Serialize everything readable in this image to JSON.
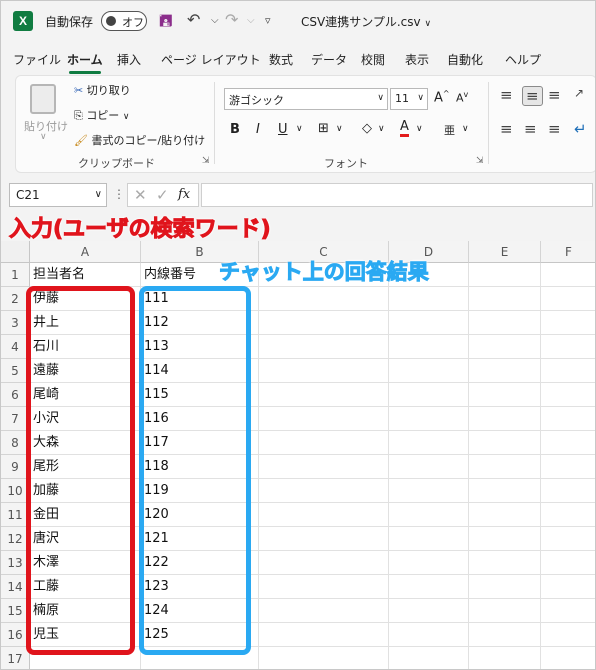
{
  "titlebar": {
    "app_icon": "excel-logo",
    "app_icon_letter": "X",
    "autosave_label": "自動保存",
    "autosave_state": "オフ",
    "filename": "CSV連携サンプル.csv"
  },
  "menu": {
    "tabs": [
      "ファイル",
      "ホーム",
      "挿入",
      "ページ レイアウト",
      "数式",
      "データ",
      "校閲",
      "表示",
      "自動化",
      "ヘルプ"
    ],
    "active_tab": "ホーム"
  },
  "ribbon": {
    "clipboard": {
      "paste_label": "貼り付け",
      "cut_label": "切り取り",
      "copy_label": "コピー",
      "format_painter_label": "書式のコピー/貼り付け",
      "group_label": "クリップボード"
    },
    "font": {
      "font_name": "游ゴシック",
      "font_size": "11",
      "group_label": "フォント"
    }
  },
  "formula_bar": {
    "name_box": "C21",
    "fx_label": "fx",
    "formula": ""
  },
  "grid": {
    "columns": [
      "A",
      "B",
      "C",
      "D",
      "E",
      "F"
    ],
    "rows": [
      {
        "num": "1",
        "a": "担当者名",
        "b": "内線番号"
      },
      {
        "num": "2",
        "a": "伊藤",
        "b": "111"
      },
      {
        "num": "3",
        "a": "井上",
        "b": "112"
      },
      {
        "num": "4",
        "a": "石川",
        "b": "113"
      },
      {
        "num": "5",
        "a": "遠藤",
        "b": "114"
      },
      {
        "num": "6",
        "a": "尾崎",
        "b": "115"
      },
      {
        "num": "7",
        "a": "小沢",
        "b": "116"
      },
      {
        "num": "8",
        "a": "大森",
        "b": "117"
      },
      {
        "num": "9",
        "a": "尾形",
        "b": "118"
      },
      {
        "num": "10",
        "a": "加藤",
        "b": "119"
      },
      {
        "num": "11",
        "a": "金田",
        "b": "120"
      },
      {
        "num": "12",
        "a": "唐沢",
        "b": "121"
      },
      {
        "num": "13",
        "a": "木澤",
        "b": "122"
      },
      {
        "num": "14",
        "a": "工藤",
        "b": "123"
      },
      {
        "num": "15",
        "a": "楠原",
        "b": "124"
      },
      {
        "num": "16",
        "a": "児玉",
        "b": "125"
      },
      {
        "num": "17",
        "a": "",
        "b": ""
      }
    ]
  },
  "annotations": {
    "input_label": "入力(ユーザの検索ワード)",
    "answer_label": "チャット上の回答結果",
    "input_color": "#e0141c",
    "answer_color": "#2aa9f2"
  }
}
